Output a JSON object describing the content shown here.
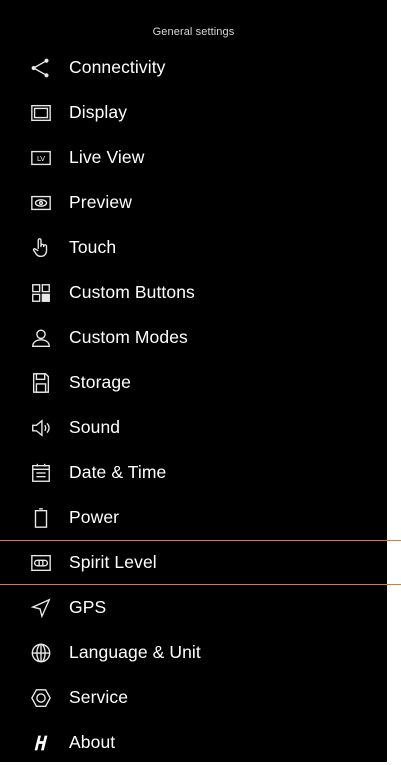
{
  "header": {
    "title": "General settings"
  },
  "colors": {
    "background": "#000000",
    "text": "#ffffff",
    "selection_line": "#e07a3a"
  },
  "menu": {
    "selected": "Spirit Level",
    "items": [
      {
        "label": "Connectivity",
        "icon": "share-icon"
      },
      {
        "label": "Display",
        "icon": "display-icon"
      },
      {
        "label": "Live View",
        "icon": "live-view-icon"
      },
      {
        "label": "Preview",
        "icon": "eye-icon"
      },
      {
        "label": "Touch",
        "icon": "hand-touch-icon"
      },
      {
        "label": "Custom Buttons",
        "icon": "grid-buttons-icon"
      },
      {
        "label": "Custom Modes",
        "icon": "person-icon"
      },
      {
        "label": "Storage",
        "icon": "sd-card-icon"
      },
      {
        "label": "Sound",
        "icon": "speaker-icon"
      },
      {
        "label": "Date & Time",
        "icon": "calendar-icon"
      },
      {
        "label": "Power",
        "icon": "battery-icon"
      },
      {
        "label": "Spirit Level",
        "icon": "spirit-level-icon"
      },
      {
        "label": "GPS",
        "icon": "location-arrow-icon"
      },
      {
        "label": "Language & Unit",
        "icon": "globe-icon"
      },
      {
        "label": "Service",
        "icon": "hexagon-icon"
      },
      {
        "label": "About",
        "icon": "h-logo-icon"
      }
    ]
  }
}
